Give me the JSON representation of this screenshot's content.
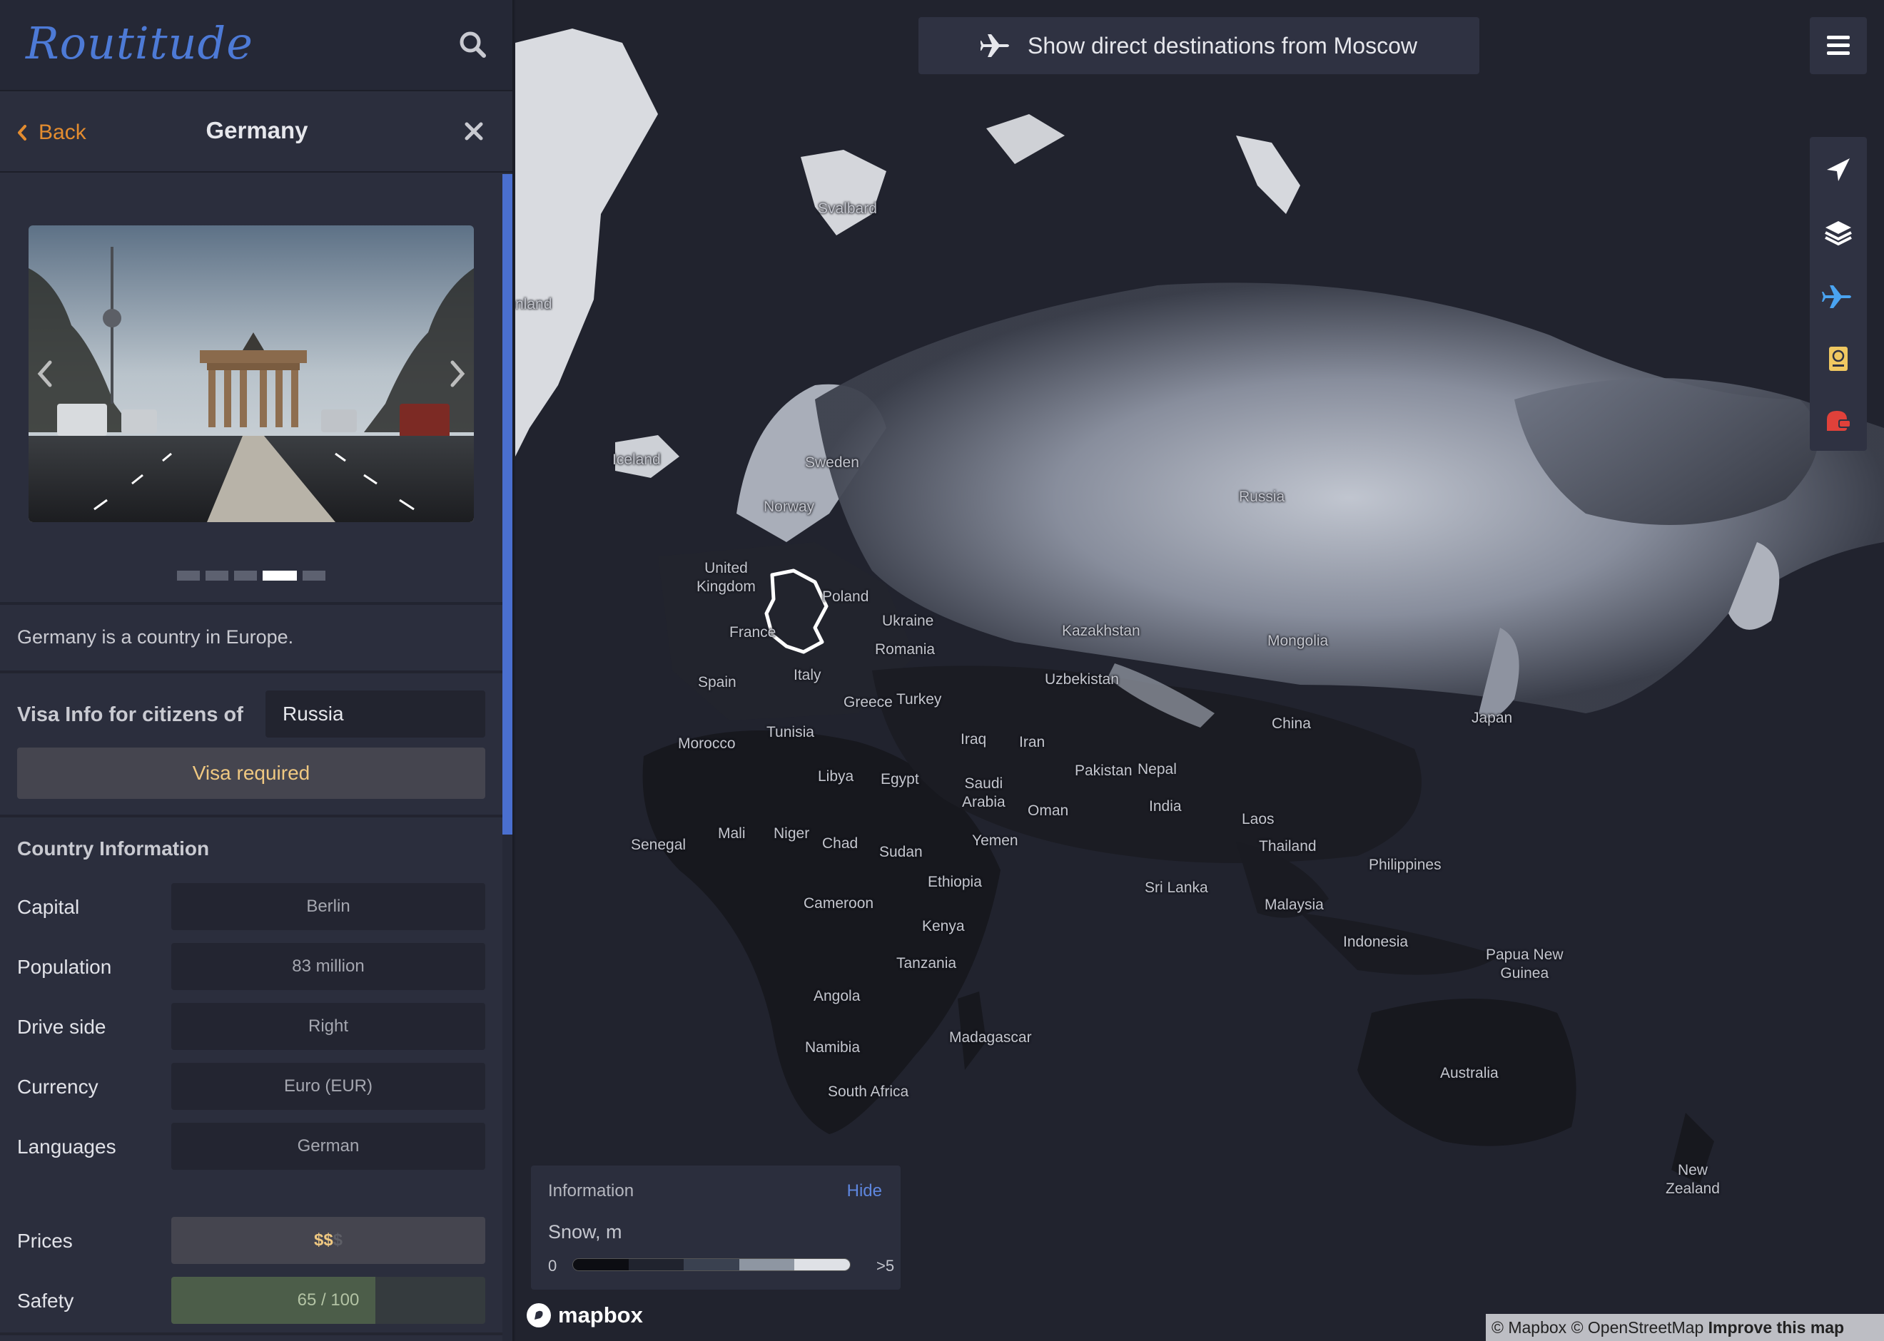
{
  "app": {
    "logo": "Routitude"
  },
  "nav": {
    "back_label": "Back",
    "country_title": "Germany"
  },
  "carousel": {
    "slide_count": 5,
    "active_slide": 4
  },
  "country": {
    "description": "Germany is a country in Europe.",
    "visa": {
      "label": "Visa Info for citizens of",
      "citizenship_value": "Russia",
      "status": "Visa required"
    },
    "info_heading": "Country Information",
    "rows": [
      {
        "label": "Capital",
        "value": "Berlin"
      },
      {
        "label": "Population",
        "value": "83 million"
      },
      {
        "label": "Drive side",
        "value": "Right"
      },
      {
        "label": "Currency",
        "value": "Euro (EUR)"
      },
      {
        "label": "Languages",
        "value": "German"
      }
    ],
    "prices": {
      "label": "Prices",
      "active": "$$",
      "inactive": "$"
    },
    "safety": {
      "label": "Safety",
      "text": "65 / 100",
      "score": 65,
      "max": 100
    }
  },
  "map": {
    "banner": "Show direct destinations from Moscow",
    "tools": [
      "location-arrow-icon",
      "layers-icon",
      "plane-icon",
      "passport-icon",
      "covid-icon"
    ],
    "tool_colors": {
      "default": "#ffffff",
      "plane": "#4aa3f0",
      "passport": "#f0c861",
      "covid": "#e0413a"
    },
    "labels": {
      "greenland_fragment": "nland",
      "svalbard": "Svalbard",
      "iceland": "Iceland",
      "sweden": "Sweden",
      "norway": "Norway",
      "russia": "Russia",
      "uk": "United\nKingdom",
      "poland": "Poland",
      "ukraine": "Ukraine",
      "france": "France",
      "romania": "Romania",
      "kazakhstan": "Kazakhstan",
      "mongolia": "Mongolia",
      "spain": "Spain",
      "italy": "Italy",
      "greece": "Greece",
      "turkey": "Turkey",
      "uzbekistan": "Uzbekistan",
      "japan": "Japan",
      "morocco": "Morocco",
      "tunisia": "Tunisia",
      "china": "China",
      "iraq": "Iraq",
      "iran": "Iran",
      "pakistan": "Pakistan",
      "nepal": "Nepal",
      "libya": "Libya",
      "egypt": "Egypt",
      "saudi": "Saudi\nArabia",
      "oman": "Oman",
      "india": "India",
      "laos": "Laos",
      "mali": "Mali",
      "niger": "Niger",
      "yemen": "Yemen",
      "senegal": "Senegal",
      "chad": "Chad",
      "sudan": "Sudan",
      "thailand": "Thailand",
      "philippines": "Philippines",
      "ethiopia": "Ethiopia",
      "sri_lanka": "Sri Lanka",
      "cameroon": "Cameroon",
      "malaysia": "Malaysia",
      "kenya": "Kenya",
      "indonesia": "Indonesia",
      "png": "Papua New\nGuinea",
      "tanzania": "Tanzania",
      "angola": "Angola",
      "madagascar": "Madagascar",
      "namibia": "Namibia",
      "australia": "Australia",
      "south_africa": "South Africa",
      "new_zealand": "New\nZealand"
    },
    "legend": {
      "title": "Information",
      "hide": "Hide",
      "variable": "Snow, m",
      "min": "0",
      "max": ">5",
      "scale_colors": [
        "#0c0d12",
        "#20232e",
        "#3a4150",
        "#8e96a2",
        "#dfe1e6"
      ]
    },
    "mapbox_wordmark": "mapbox",
    "attribution": {
      "mapbox": "© Mapbox",
      "osm": "© OpenStreetMap",
      "improve": "Improve this map"
    }
  }
}
